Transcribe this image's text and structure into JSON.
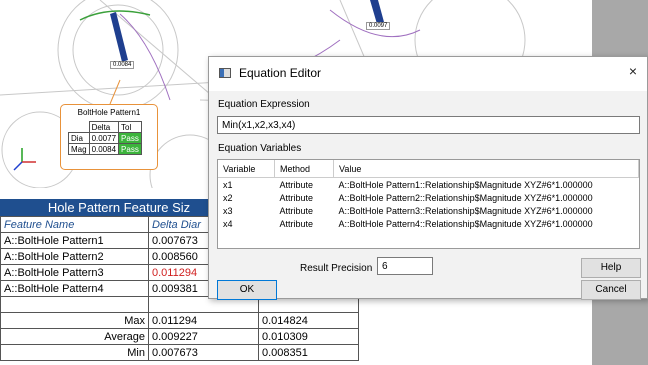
{
  "cad": {
    "label_left": "0.0084",
    "label_right": "0.0097",
    "callout": {
      "title": "BoltHole Pattern1",
      "col_delta": "Delta",
      "col_tol": "Tol",
      "rows": [
        {
          "name": "Dia",
          "delta": "0.0077",
          "tol": "Pass"
        },
        {
          "name": "Mag",
          "delta": "0.0084",
          "tol": "Pass"
        }
      ]
    }
  },
  "report": {
    "title": "Hole Pattern Feature Siz",
    "col_feature": "Feature Name",
    "col_delta": "Delta Diar",
    "rows": [
      {
        "name": "A::BoltHole Pattern1",
        "delta": "0.007673",
        "over": false
      },
      {
        "name": "A::BoltHole Pattern2",
        "delta": "0.008560",
        "over": false
      },
      {
        "name": "A::BoltHole Pattern3",
        "delta": "0.011294",
        "over": true
      },
      {
        "name": "A::BoltHole Pattern4",
        "delta": "0.009381",
        "over": false
      }
    ],
    "summary": [
      {
        "label": "Max",
        "v1": "0.011294",
        "v2": "0.014824"
      },
      {
        "label": "Average",
        "v1": "0.009227",
        "v2": "0.010309"
      },
      {
        "label": "Min",
        "v1": "0.007673",
        "v2": "0.008351"
      }
    ],
    "colors": {
      "header_bg": "#1f4f8f",
      "over_text": "#d02020"
    }
  },
  "dialog": {
    "title": "Equation Editor",
    "close": "×",
    "expr_label": "Equation Expression",
    "expr_value": "Min(x1,x2,x3,x4)",
    "vars_label": "Equation Variables",
    "columns": [
      "Variable",
      "Method",
      "Value"
    ],
    "variables": [
      {
        "var": "x1",
        "method": "Attribute",
        "value": "A::BoltHole Pattern1::Relationship$Magnitude XYZ#6*1.000000"
      },
      {
        "var": "x2",
        "method": "Attribute",
        "value": "A::BoltHole Pattern2::Relationship$Magnitude XYZ#6*1.000000"
      },
      {
        "var": "x3",
        "method": "Attribute",
        "value": "A::BoltHole Pattern3::Relationship$Magnitude XYZ#6*1.000000"
      },
      {
        "var": "x4",
        "method": "Attribute",
        "value": "A::BoltHole Pattern4::Relationship$Magnitude XYZ#6*1.000000"
      }
    ],
    "precision_label": "Result Precision",
    "precision_value": "6",
    "help_label": "Help",
    "ok_label": "OK",
    "cancel_label": "Cancel"
  }
}
